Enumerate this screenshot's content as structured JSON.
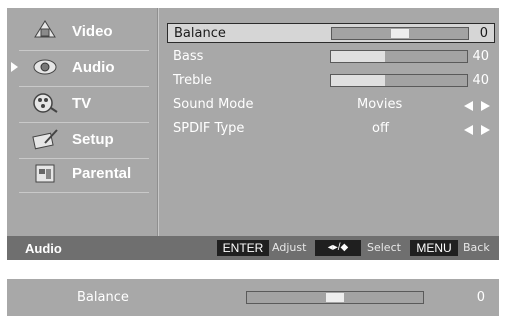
{
  "sidebar": {
    "items": [
      {
        "label": "Video",
        "icon": "video-icon",
        "active": false
      },
      {
        "label": "Audio",
        "icon": "audio-icon",
        "active": true
      },
      {
        "label": "TV",
        "icon": "tv-icon",
        "active": false
      },
      {
        "label": "Setup",
        "icon": "setup-icon",
        "active": false
      },
      {
        "label": "Parental",
        "icon": "parental-icon",
        "active": false
      }
    ]
  },
  "settings": {
    "balance": {
      "label": "Balance",
      "value": "0",
      "level": 0.5
    },
    "bass": {
      "label": "Bass",
      "value": "40",
      "level": 0.4
    },
    "treble": {
      "label": "Treble",
      "value": "40",
      "level": 0.4
    },
    "sound_mode": {
      "label": "Sound Mode",
      "value": "Movies"
    },
    "spdif": {
      "label": "SPDIF Type",
      "value": "off"
    }
  },
  "bottom_bar": {
    "title": "Audio",
    "keys": [
      {
        "key": "ENTER",
        "action": "Adjust"
      },
      {
        "key": "◂▸/◆",
        "action": "Select"
      },
      {
        "key": "MENU",
        "action": "Back"
      }
    ]
  },
  "strip": {
    "label": "Balance",
    "value": "0",
    "level": 0.5
  },
  "colors": {
    "panel": "#a8a8a8",
    "bar_bottom": "#6f6f6f",
    "key_bg": "#1f1f1f",
    "selected_row": "#d6d6d6"
  }
}
